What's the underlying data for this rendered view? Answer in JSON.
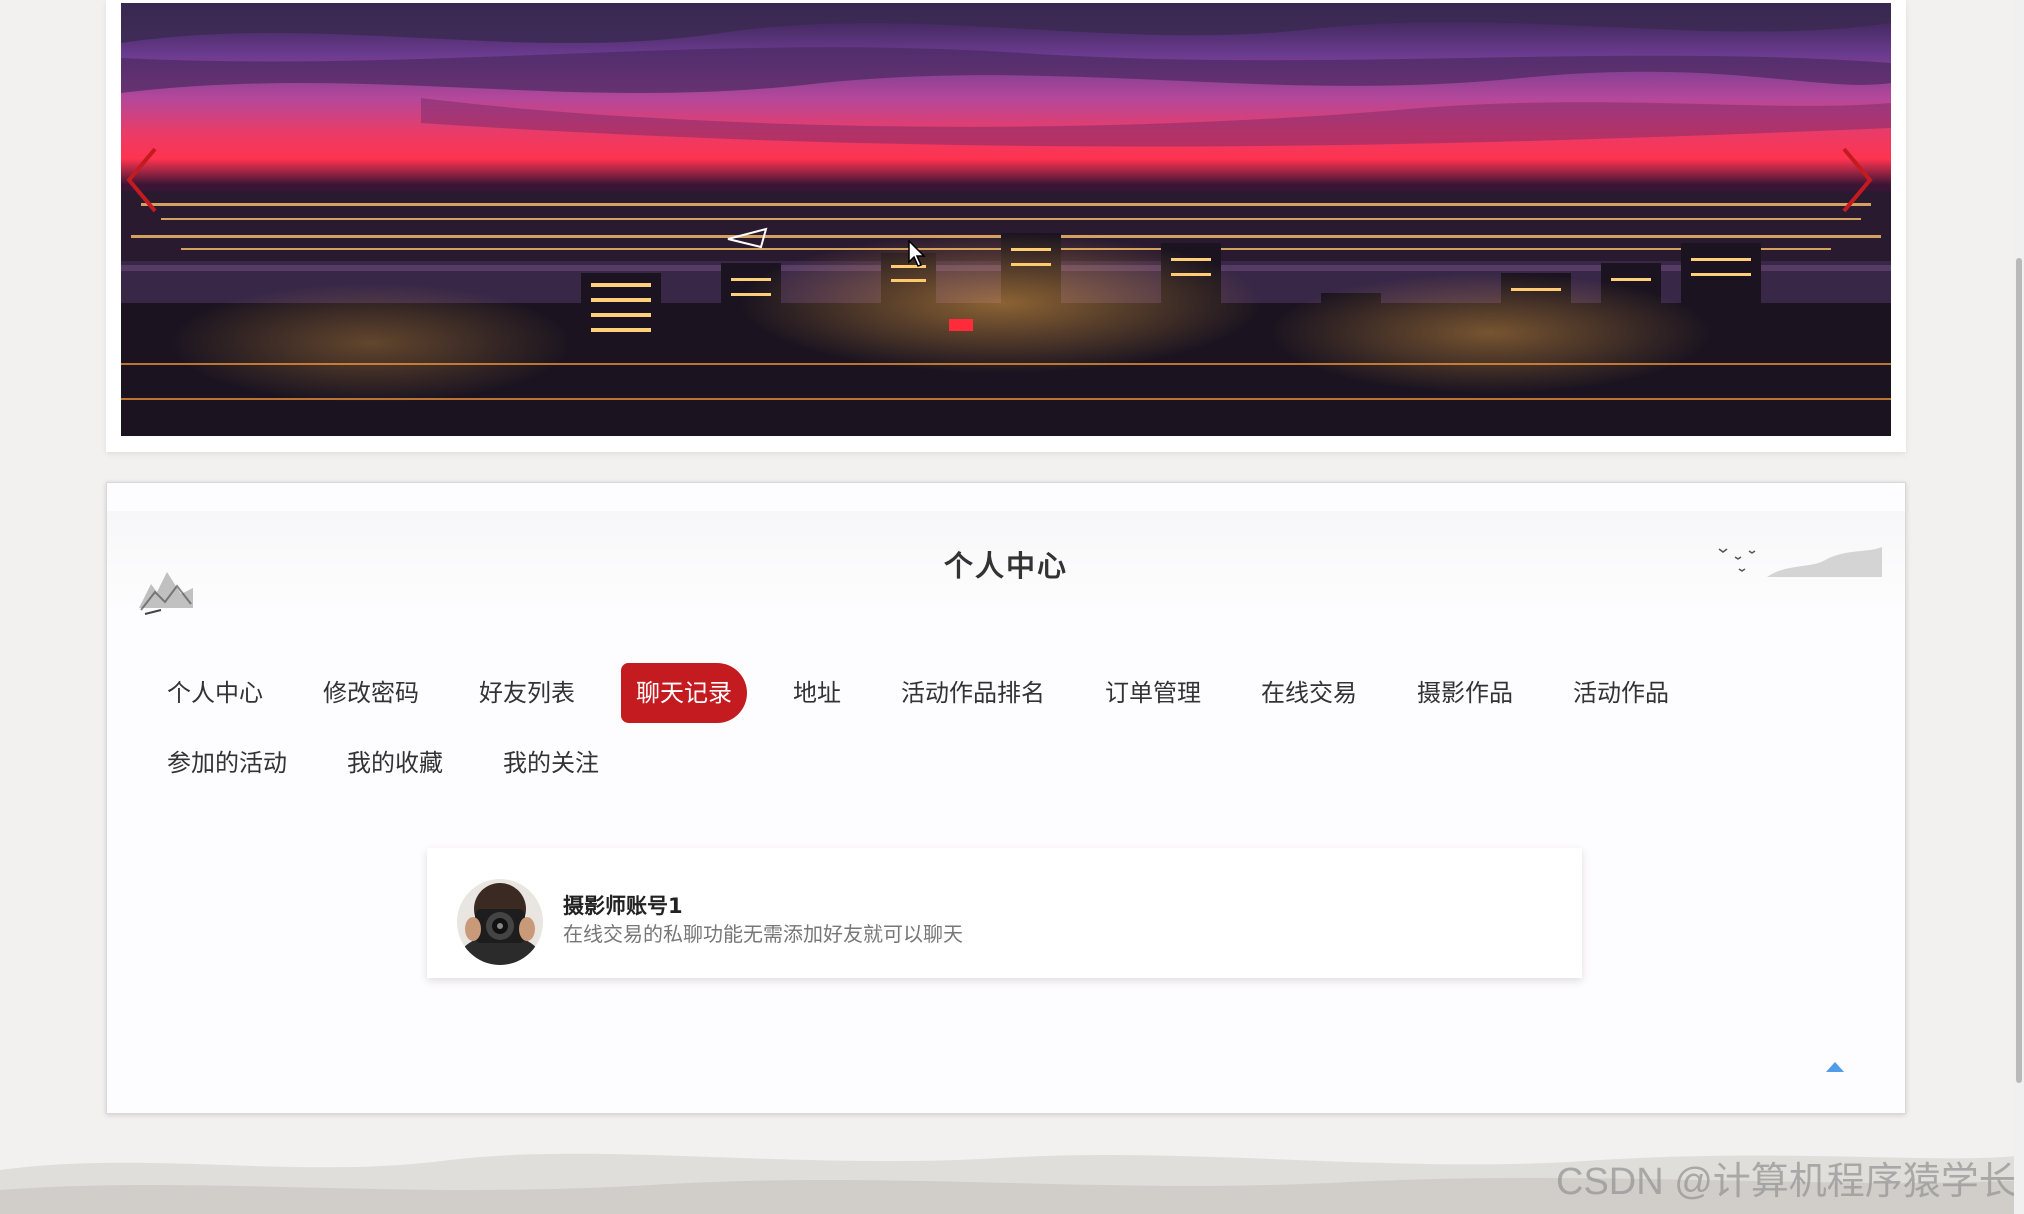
{
  "banner": {
    "prev_icon": "chevron-left-icon",
    "next_icon": "chevron-right-icon",
    "image_subject": "city-night-skyline"
  },
  "panel": {
    "title": "个人中心",
    "nav_row1": [
      "个人中心",
      "修改密码",
      "好友列表",
      "聊天记录",
      "地址",
      "活动作品排名",
      "订单管理",
      "在线交易",
      "摄影作品",
      "活动作品"
    ],
    "nav_row2": [
      "参加的活动",
      "我的收藏",
      "我的关注"
    ],
    "active_tab": "聊天记录",
    "chat": {
      "name": "摄影师账号1",
      "message": "在线交易的私聊功能无需添加好友就可以聊天",
      "avatar_icon": "photographer-avatar"
    },
    "back_to_top_icon": "arrow-up-icon"
  },
  "watermark": "CSDN @计算机程序猿学长",
  "colors": {
    "accent_red": "#c41b21",
    "panel_bg": "#fdfcfe",
    "page_bg": "#f2f1ef",
    "top_arrow_blue": "#4f9de8"
  }
}
